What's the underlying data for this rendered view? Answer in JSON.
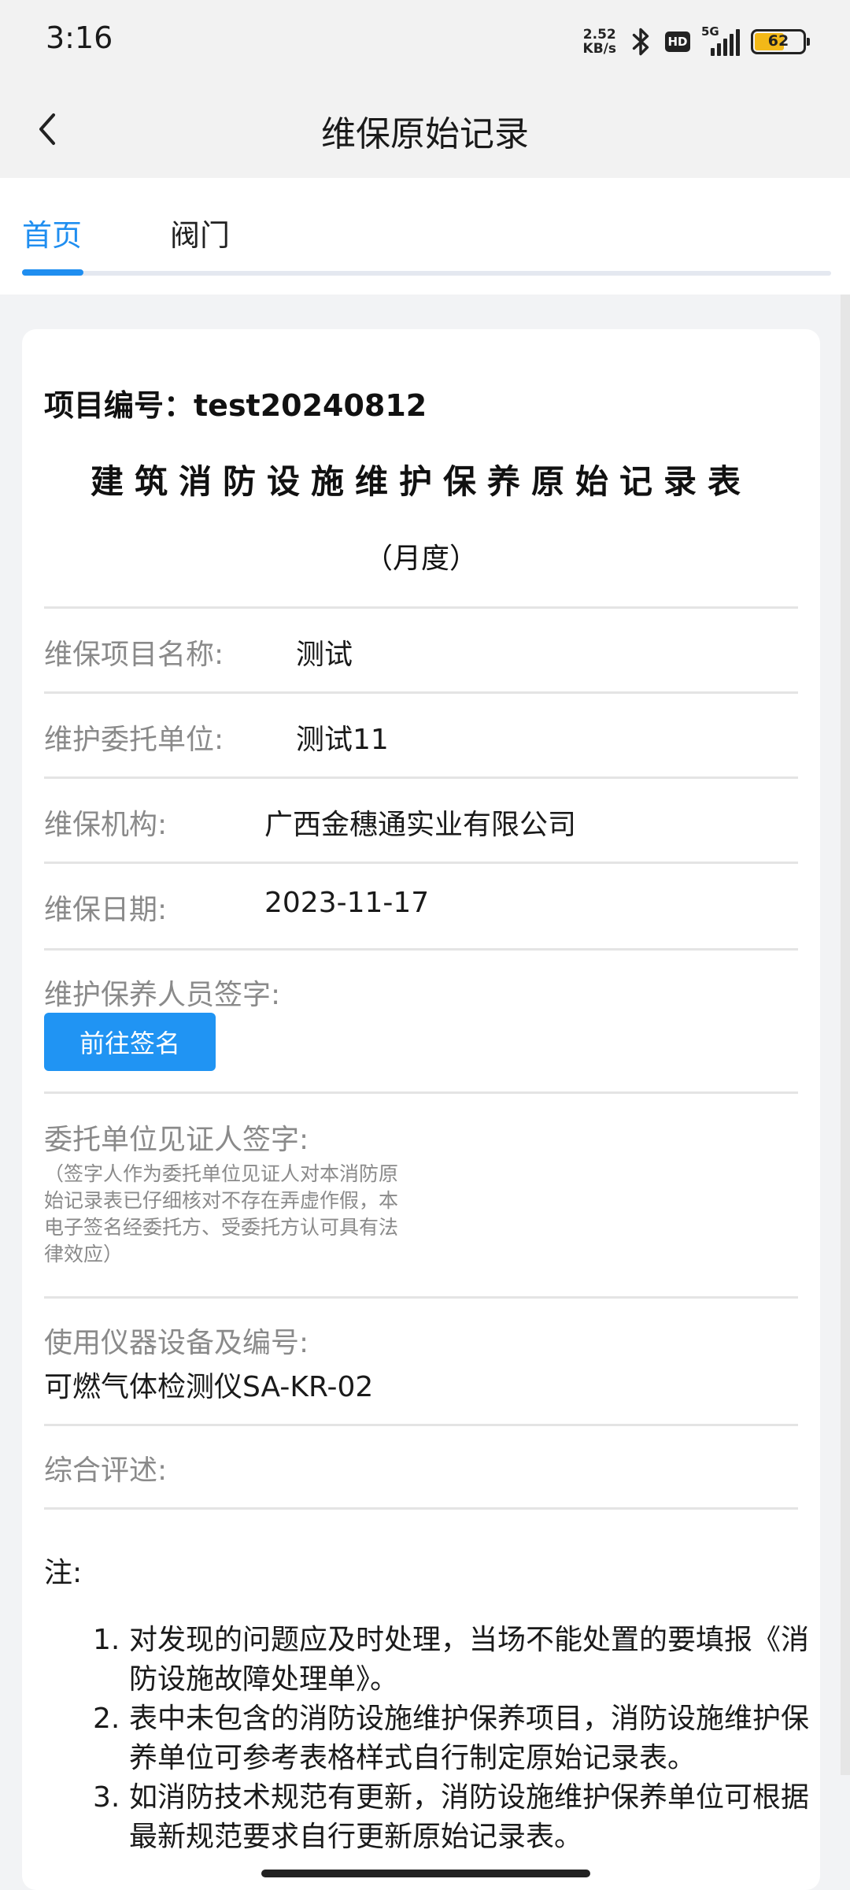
{
  "status": {
    "time": "3:16",
    "net_speed_value": "2.52",
    "net_speed_unit": "KB/s",
    "hd": "HD",
    "network": "5G",
    "battery": "62"
  },
  "nav": {
    "title": "维保原始记录"
  },
  "tabs": [
    {
      "label": "首页",
      "active": true
    },
    {
      "label": "阀门",
      "active": false
    }
  ],
  "form": {
    "project_no": "项目编号：test20240812",
    "title": "建筑消防设施维护保养原始记录表",
    "subtitle": "（月度）",
    "rows": {
      "project_name": {
        "label": "维保项目名称:",
        "value": "测试"
      },
      "client": {
        "label": "维护委托单位:",
        "value": "测试11"
      },
      "org": {
        "label": "维保机构:",
        "value": "广西金穗通实业有限公司"
      },
      "date": {
        "label": "维保日期:",
        "value": "2023-11-17"
      }
    },
    "staff_sign": {
      "label": "维护保养人员签字:",
      "button": "前往签名"
    },
    "witness_sign": {
      "label": "委托单位见证人签字:",
      "note": "（签字人作为委托单位见证人对本消防原始记录表已仔细核对不存在弄虚作假，本电子签名经委托方、受委托方认可具有法律效应）"
    },
    "equipment": {
      "label": "使用仪器设备及编号:",
      "value": "可燃气体检测仪SA-KR-02"
    },
    "summary": {
      "label": "综合评述:"
    },
    "notes": {
      "title": "注:",
      "items": [
        {
          "num": "1.",
          "text": "对发现的问题应及时处理，当场不能处置的要填报《消防设施故障处理单》。"
        },
        {
          "num": "2.",
          "text": "表中未包含的消防设施维护保养项目，消防设施维护保养单位可参考表格样式自行制定原始记录表。"
        },
        {
          "num": "3.",
          "text": "如消防技术规范有更新，消防设施维护保养单位可根据最新规范要求自行更新原始记录表。"
        }
      ]
    }
  }
}
